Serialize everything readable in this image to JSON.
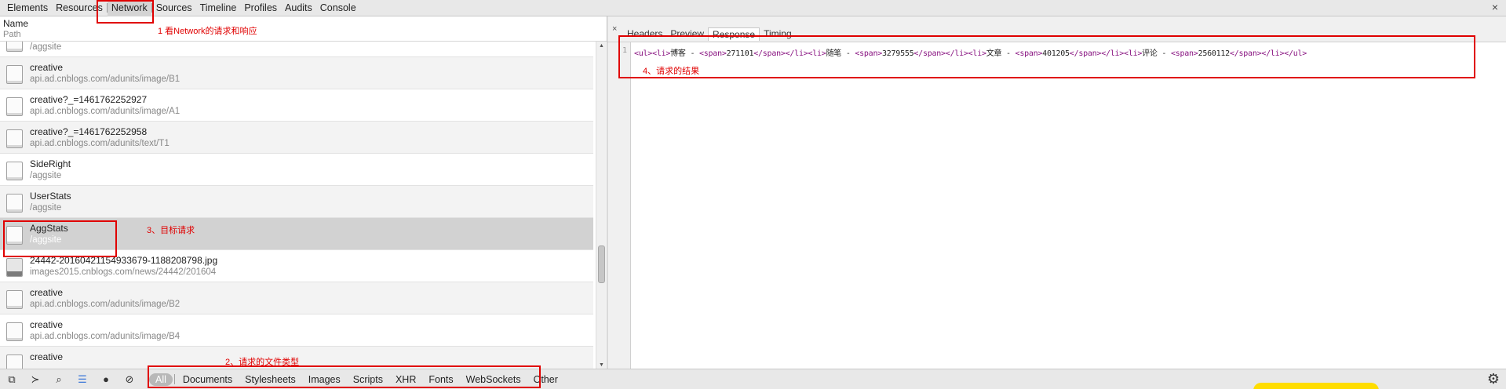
{
  "toolbar": {
    "tabs": [
      "Elements",
      "Resources",
      "Network",
      "Sources",
      "Timeline",
      "Profiles",
      "Audits",
      "Console"
    ],
    "active_tab": "Network",
    "close": "×"
  },
  "list": {
    "header_name": "Name",
    "header_path": "Path",
    "rows": [
      {
        "name": "",
        "path": "/aggsite"
      },
      {
        "name": "creative",
        "path": "api.ad.cnblogs.com/adunits/image/B1"
      },
      {
        "name": "creative?_=1461762252927",
        "path": "api.ad.cnblogs.com/adunits/image/A1"
      },
      {
        "name": "creative?_=1461762252958",
        "path": "api.ad.cnblogs.com/adunits/text/T1"
      },
      {
        "name": "SideRight",
        "path": "/aggsite"
      },
      {
        "name": "UserStats",
        "path": "/aggsite"
      },
      {
        "name": "AggStats",
        "path": "/aggsite"
      },
      {
        "name": "24442-20160421154933679-1188208798.jpg",
        "path": "images2015.cnblogs.com/news/24442/201604"
      },
      {
        "name": "creative",
        "path": "api.ad.cnblogs.com/adunits/image/B2"
      },
      {
        "name": "creative",
        "path": "api.ad.cnblogs.com/adunits/image/B4"
      },
      {
        "name": "creative",
        "path": ""
      }
    ],
    "scrollbar_position": 0.72
  },
  "detail": {
    "close": "×",
    "tabs": [
      "Headers",
      "Preview",
      "Response",
      "Timing"
    ],
    "active_tab": "Response",
    "line_number": "1",
    "code": [
      {
        "t": "tag",
        "s": "<ul><li>"
      },
      {
        "t": "text",
        "s": "博客 - "
      },
      {
        "t": "tag",
        "s": "<span>"
      },
      {
        "t": "text",
        "s": "271101"
      },
      {
        "t": "tag",
        "s": "</span></li><li>"
      },
      {
        "t": "text",
        "s": "随笔 - "
      },
      {
        "t": "tag",
        "s": "<span>"
      },
      {
        "t": "text",
        "s": "3279555"
      },
      {
        "t": "tag",
        "s": "</span></li><li>"
      },
      {
        "t": "text",
        "s": "文章 - "
      },
      {
        "t": "tag",
        "s": "<span>"
      },
      {
        "t": "text",
        "s": "401205"
      },
      {
        "t": "tag",
        "s": "</span></li><li>"
      },
      {
        "t": "text",
        "s": "评论 - "
      },
      {
        "t": "tag",
        "s": "<span>"
      },
      {
        "t": "text",
        "s": "2560112"
      },
      {
        "t": "tag",
        "s": "</span></li></ul>"
      }
    ]
  },
  "bottom": {
    "filters": [
      "All",
      "Documents",
      "Stylesheets",
      "Images",
      "Scripts",
      "XHR",
      "Fonts",
      "WebSockets",
      "Other"
    ],
    "active_filter": "All"
  },
  "annotations": {
    "a1": "1 看Network的请求和响应",
    "a2": "2、请求的文件类型",
    "a3": "3、目标请求",
    "a4": "4、请求的结果"
  },
  "colors": {
    "annotation": "#e00000",
    "tag": "#881280",
    "selected_row": "#d2d2d2"
  }
}
